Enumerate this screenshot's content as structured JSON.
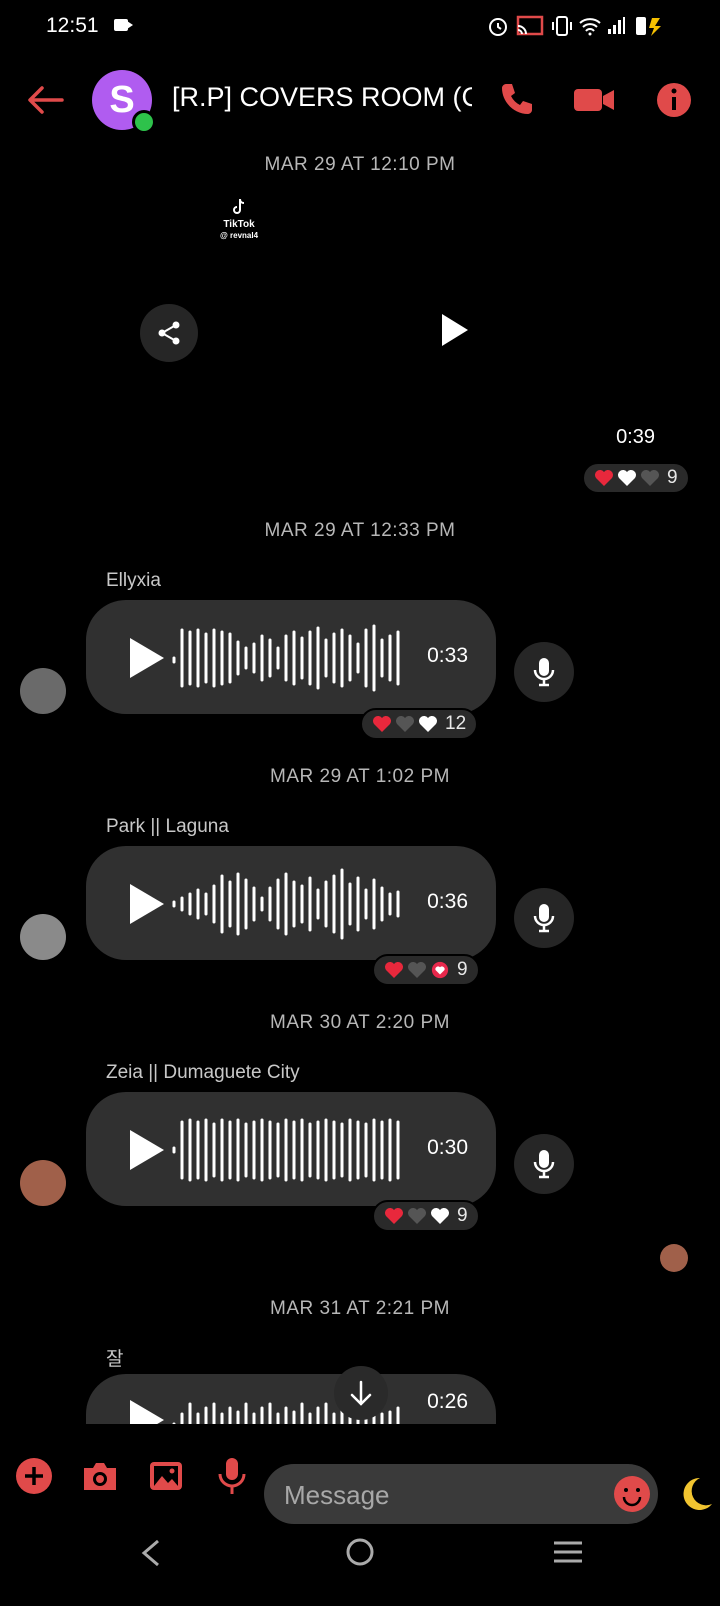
{
  "status_bar": {
    "time": "12:51"
  },
  "header": {
    "title": "[R.P] COVERS ROOM (C...",
    "avatar_letter": "S"
  },
  "messages": [
    {
      "stamp": "MAR 29 AT 12:10 PM",
      "type": "video",
      "brand": "TikTok",
      "handle": "@ revnal4",
      "duration": "0:39",
      "reaction_count": "9"
    },
    {
      "stamp": "MAR 29 AT 12:33 PM",
      "sender": "Ellyxia",
      "duration": "0:33",
      "reaction_count": "12"
    },
    {
      "stamp": "MAR 29 AT 1:02 PM",
      "sender": "Park || Laguna",
      "duration": "0:36",
      "reaction_count": "9"
    },
    {
      "stamp": "MAR 30 AT 2:20 PM",
      "sender": "Zeia || Dumaguete City",
      "duration": "0:30",
      "reaction_count": "9"
    },
    {
      "stamp": "MAR 31 AT 2:21 PM",
      "sender": "잘",
      "duration": "0:26"
    }
  ],
  "composer": {
    "placeholder": "Message"
  },
  "colors": {
    "accent": "#e04a4a",
    "avatar": "#b05cf0",
    "online": "#2ec24b",
    "bubble": "#303030"
  }
}
